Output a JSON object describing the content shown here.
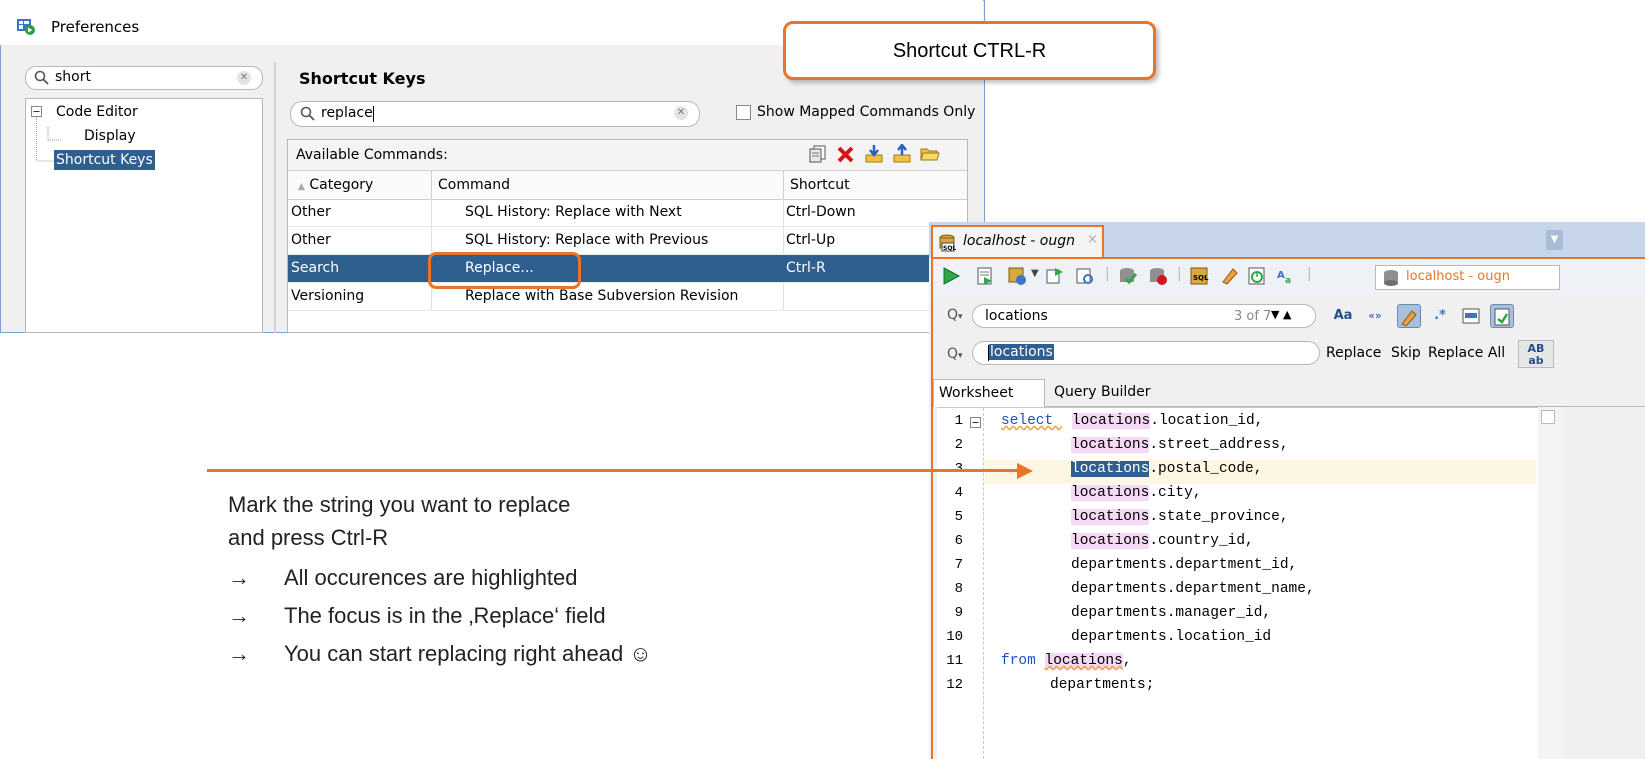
{
  "preferences": {
    "title": "Preferences",
    "filter_value": "short",
    "tree": [
      "Code Editor",
      "Display",
      "Shortcut Keys"
    ],
    "section_title": "Shortcut Keys",
    "search_value": "replace",
    "show_mapped_label": "Show Mapped Commands Only",
    "available_commands_label": "Available Commands:",
    "columns": [
      "Category",
      "Command",
      "Shortcut"
    ],
    "rows": [
      {
        "category": "Other",
        "command": "SQL History: Replace with Next",
        "shortcut": "Ctrl-Down"
      },
      {
        "category": "Other",
        "command": "SQL History: Replace with Previous",
        "shortcut": "Ctrl-Up"
      },
      {
        "category": "Search",
        "command": "Replace...",
        "shortcut": "Ctrl-R"
      },
      {
        "category": "Versioning",
        "command": "Replace with Base Subversion Revision",
        "shortcut": ""
      }
    ],
    "selected_row": 2
  },
  "callout": {
    "text": "Shortcut CTRL-R"
  },
  "sql_developer": {
    "tab_title": "localhost - ougn",
    "tab_close": "×",
    "connection": "localhost - ougn",
    "find_value": "locations",
    "find_count": "3 of 7",
    "find_nav": "▼ ▲",
    "replace_value": "locations",
    "replace_label": "Replace",
    "skip_label": "Skip",
    "replace_all_label": "Replace All",
    "case_button": "Aa",
    "quote_button": "«»",
    "ab_button_top": "AB",
    "ab_button_bottom": "ab",
    "worksheet_tab": "Worksheet",
    "query_builder_tab": "Query Builder",
    "line_numbers": [
      "1",
      "2",
      "3",
      "4",
      "5",
      "6",
      "7",
      "8",
      "9",
      "10",
      "11",
      "12"
    ],
    "code_lines": [
      [
        "select ",
        "locations",
        ".location_id,"
      ],
      [
        "",
        "locations",
        ".street_address,"
      ],
      [
        "",
        "locations",
        ".postal_code,"
      ],
      [
        "",
        "locations",
        ".city,"
      ],
      [
        "",
        "locations",
        ".state_province,"
      ],
      [
        "",
        "locations",
        ".country_id,"
      ],
      [
        "",
        "",
        "departments.department_id,"
      ],
      [
        "",
        "",
        "departments.department_name,"
      ],
      [
        "",
        "",
        "departments.manager_id,"
      ],
      [
        "",
        "",
        "departments.location_id"
      ],
      [
        "from ",
        "locations",
        ","
      ],
      [
        "",
        "",
        "departments;"
      ]
    ]
  },
  "annotation": {
    "line1": "Mark the string you want to replace",
    "line2": "and press Ctrl-R",
    "arrow": "→",
    "bullets": [
      "All occurences are highlighted",
      "The focus is in the ‚Replace‘ field",
      "You can start replacing right ahead ☺"
    ]
  },
  "colors": {
    "accent": "#e8752a",
    "selection": "#2f5f8f",
    "highlight": "#f5d8f5"
  }
}
